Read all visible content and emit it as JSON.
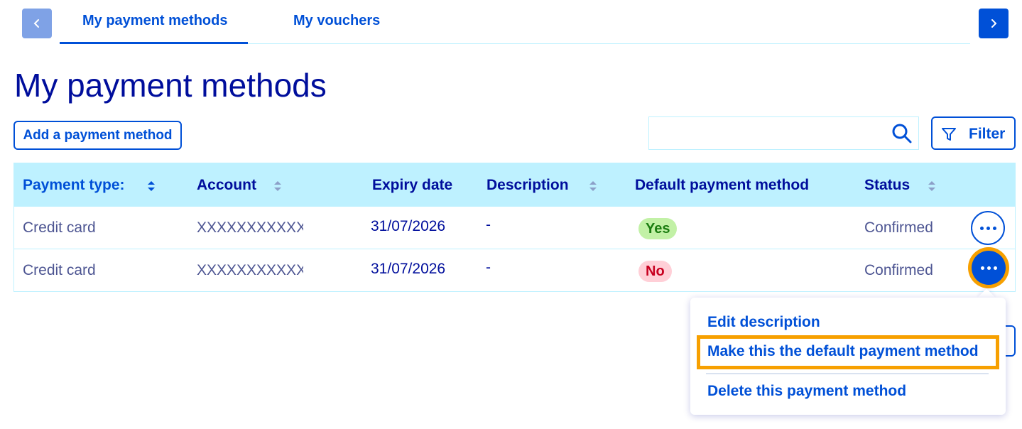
{
  "tabs": {
    "prev_icon": "chevron-left-icon",
    "next_icon": "chevron-right-icon",
    "items": [
      {
        "label": "My payment methods",
        "active": true
      },
      {
        "label": "My vouchers",
        "active": false
      }
    ]
  },
  "page": {
    "title": "My payment methods"
  },
  "toolbar": {
    "add_label": "Add a payment method",
    "search_value": "",
    "search_placeholder": "",
    "search_icon": "search-icon",
    "filter_label": "Filter",
    "filter_icon": "filter-icon"
  },
  "table": {
    "headers": [
      {
        "label": "Payment type:",
        "sortable": true
      },
      {
        "label": "Account",
        "sortable": true
      },
      {
        "label": "Expiry date",
        "sortable": false
      },
      {
        "label": "Description",
        "sortable": true
      },
      {
        "label": "Default payment method",
        "sortable": false
      },
      {
        "label": "Status",
        "sortable": true
      }
    ],
    "rows": [
      {
        "type": "Credit card",
        "account": "XXXXXXXXXXXX",
        "expiry": "31/07/2026",
        "description": "-",
        "default": "Yes",
        "status": "Confirmed"
      },
      {
        "type": "Credit card",
        "account": "XXXXXXXXXXXX",
        "expiry": "31/07/2026",
        "description": "-",
        "default": "No",
        "status": "Confirmed"
      }
    ]
  },
  "menu": {
    "items": [
      {
        "label": "Edit description"
      },
      {
        "label": "Make this the default payment method",
        "highlighted": true
      },
      {
        "label": "Delete this payment method"
      }
    ]
  },
  "colors": {
    "primary": "#0050d7",
    "dark_text": "#000e9c",
    "header_bg": "#bef1ff",
    "highlight": "#f7a000",
    "badge_yes_bg": "#c2f1a6",
    "badge_no_bg": "#ffcfd7"
  }
}
